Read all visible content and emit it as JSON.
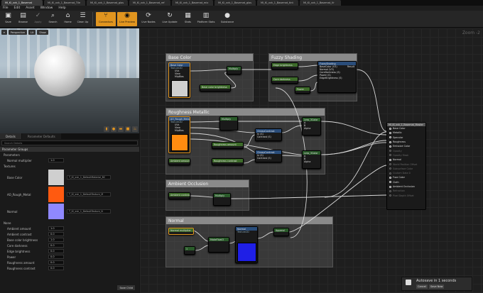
{
  "tabs": [
    "MI_Kl_xvk_1_Basemat",
    "MI_Kl_xvk_1_Basemat_Tile",
    "MI_Kl_xvk_1_Basemat_glos",
    "MI_Kl_xvk_1_Basemat_ref",
    "MI_Kl_xvk_1_Basemat_mix",
    "MI_Kl_xvk_1_Basemat_glos",
    "MI_Kl_xvk_1_Basemat_tint",
    "MI_Kl_xvk_1_Basemat_Vr"
  ],
  "menu": [
    "File",
    "Edit",
    "Asset",
    "Window",
    "Help"
  ],
  "toolbar": [
    "Save",
    "Browse",
    "Apply",
    "Search",
    "Home",
    "Clean Up",
    "Connectors",
    "Live Preview",
    "Live Nodes",
    "Live Update",
    "Stats",
    "Platform Stats",
    "Mobile Stats",
    "Substance"
  ],
  "viewport": {
    "perspective": "Perspective",
    "lit": "Lit",
    "show": "Show"
  },
  "details": {
    "tab_details": "Details",
    "tab_defaults": "Parameter Defaults",
    "search_placeholder": "Search Details",
    "section_groups": "Parameter Groups",
    "section_params": "Parameters",
    "normal_multiplier_label": "Normal multiplier",
    "normal_multiplier_value": "1.0",
    "section_textures": "Textures",
    "textures": [
      {
        "label": "Base Color",
        "asset": "T_Kl_xvk_1_DefaultMaterial_BC",
        "color": "#cfcfcf"
      },
      {
        "label": "AO_Rough_Metal",
        "asset": "T_Kl_xvk_1_DefaultTexture_M",
        "color": "#ff5a10"
      },
      {
        "label": "Normal",
        "asset": "T_Kl_xvk_1_DefaultTexture_N",
        "color": "#8f88ff"
      }
    ],
    "section_none": "None",
    "params": [
      {
        "label": "Ambient amount",
        "value": "1.0"
      },
      {
        "label": "Ambient contrast",
        "value": "0.0"
      },
      {
        "label": "Base color brightness",
        "value": "1.0"
      },
      {
        "label": "Core darkness",
        "value": "0.0"
      },
      {
        "label": "Edge brightness",
        "value": "0.0"
      },
      {
        "label": "Power",
        "value": "0.0"
      },
      {
        "label": "Roughness amount",
        "value": "0.0"
      },
      {
        "label": "Roughness contrast",
        "value": "0.0"
      }
    ],
    "save_child": "Save Child"
  },
  "graph": {
    "zoom": "Zoom -2",
    "comments": {
      "base_color": "Base Color",
      "fuzzy": "Fuzzy Shading",
      "roughness": "Roughness Metallic",
      "ao": "Ambient Occlusion",
      "normal": "Normal"
    },
    "nodes": {
      "base_tex": "Base Color",
      "base_tex_sub": "Texture2D",
      "pin_uvs": "UVs",
      "pin_view_mip": "View MipBias",
      "multiply": "Multiply",
      "base_bright": "Base color brightness",
      "edge_bright": "Edge brightness",
      "core_dark": "Core darkness",
      "power": "Power",
      "fuzzy_fn": "FuzzyShading",
      "fuzzy_pins": [
        "BaseColor (V3)",
        "Normal (V3)",
        "CoreDarkness (S)",
        "Power (S)",
        "EdgeBrightness (S)"
      ],
      "result": "Result",
      "rough_tex": "AO_Rough_Metal",
      "rough_amount": "Roughness amount",
      "rough_contrast": "Roughness contrast",
      "ambient_amount": "Ambient amount",
      "ambient_contrast": "Ambient contrast",
      "cheap_contrast": "CheapContrast",
      "cheap_pins": [
        "In (S)",
        "Contrast (S)"
      ],
      "lerp": "Lerp_3Color",
      "lerp_pins": [
        "A",
        "B",
        "Alpha"
      ],
      "normal_mult": "Normal multiplier",
      "make_float": "MakeFloat3",
      "normal_tex": "Normal",
      "append": "Append",
      "const_val": "1"
    },
    "material": {
      "title": "MI_Kl_xvk_1_Basemat_Master",
      "pins": [
        {
          "label": "Base Color",
          "on": true
        },
        {
          "label": "Metallic",
          "on": true
        },
        {
          "label": "Specular",
          "on": true
        },
        {
          "label": "Roughness",
          "on": true
        },
        {
          "label": "Emissive Color",
          "on": true
        },
        {
          "label": "Opacity",
          "on": false
        },
        {
          "label": "Opacity Mask",
          "on": false
        },
        {
          "label": "Normal",
          "on": true
        },
        {
          "label": "World Position Offset",
          "on": false
        },
        {
          "label": "Subsurface Color",
          "on": false
        },
        {
          "label": "Custom Data 0",
          "on": false
        },
        {
          "label": "Fuzz Color",
          "on": true
        },
        {
          "label": "Cloth",
          "on": true
        },
        {
          "label": "Ambient Occlusion",
          "on": true
        },
        {
          "label": "Refraction",
          "on": false
        },
        {
          "label": "Pixel Depth Offset",
          "on": false
        }
      ]
    }
  },
  "toast": {
    "text": "Autosave in 1 seconds",
    "cancel": "Cancel",
    "save_now": "Save Now"
  }
}
